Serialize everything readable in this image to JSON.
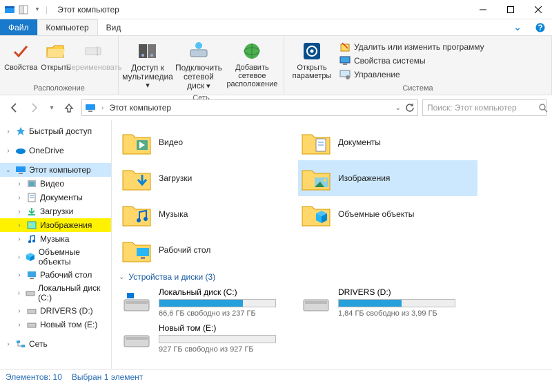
{
  "window": {
    "title": "Этот компьютер"
  },
  "tabs": {
    "file": "Файл",
    "computer": "Компьютер",
    "view": "Вид"
  },
  "ribbon": {
    "location": {
      "label": "Расположение",
      "properties": "Свойства",
      "open": "Открыть",
      "rename": "Переименовать"
    },
    "network": {
      "label": "Сеть",
      "media": "Доступ к мультимедиа",
      "map_drive": "Подключить сетевой диск",
      "add_location": "Добавить сетевое расположение"
    },
    "system": {
      "label": "Система",
      "open_params": "Открыть параметры",
      "uninstall": "Удалить или изменить программу",
      "sys_props": "Свойства системы",
      "manage": "Управление"
    }
  },
  "address": {
    "crumb": "Этот компьютер",
    "search_placeholder": "Поиск: Этот компьютер"
  },
  "tree": {
    "quick": "Быстрый доступ",
    "onedrive": "OneDrive",
    "this_pc": "Этот компьютер",
    "videos": "Видео",
    "documents": "Документы",
    "downloads": "Загрузки",
    "pictures": "Изображения",
    "music": "Музыка",
    "objects3d": "Объемные объекты",
    "desktop": "Рабочий стол",
    "local_disk": "Локальный диск (C:)",
    "drivers": "DRIVERS (D:)",
    "newvol": "Новый том (E:)",
    "network": "Сеть"
  },
  "folders": [
    {
      "key": "videos",
      "label": "Видео"
    },
    {
      "key": "documents",
      "label": "Документы"
    },
    {
      "key": "downloads",
      "label": "Загрузки"
    },
    {
      "key": "pictures",
      "label": "Изображения",
      "selected": true
    },
    {
      "key": "music",
      "label": "Музыка"
    },
    {
      "key": "objects3d",
      "label": "Объемные объекты"
    },
    {
      "key": "desktop",
      "label": "Рабочий стол"
    }
  ],
  "drives_header": "Устройства и диски (3)",
  "drives": [
    {
      "name": "Локальный диск (C:)",
      "free_text": "66,6 ГБ свободно из 237 ГБ",
      "fill_pct": 72
    },
    {
      "name": "DRIVERS (D:)",
      "free_text": "1,84 ГБ свободно из 3,99 ГБ",
      "fill_pct": 54
    },
    {
      "name": "Новый том (E:)",
      "free_text": "927 ГБ свободно из 927 ГБ",
      "fill_pct": 0
    }
  ],
  "status": {
    "count": "Элементов: 10",
    "selected": "Выбран 1 элемент"
  }
}
